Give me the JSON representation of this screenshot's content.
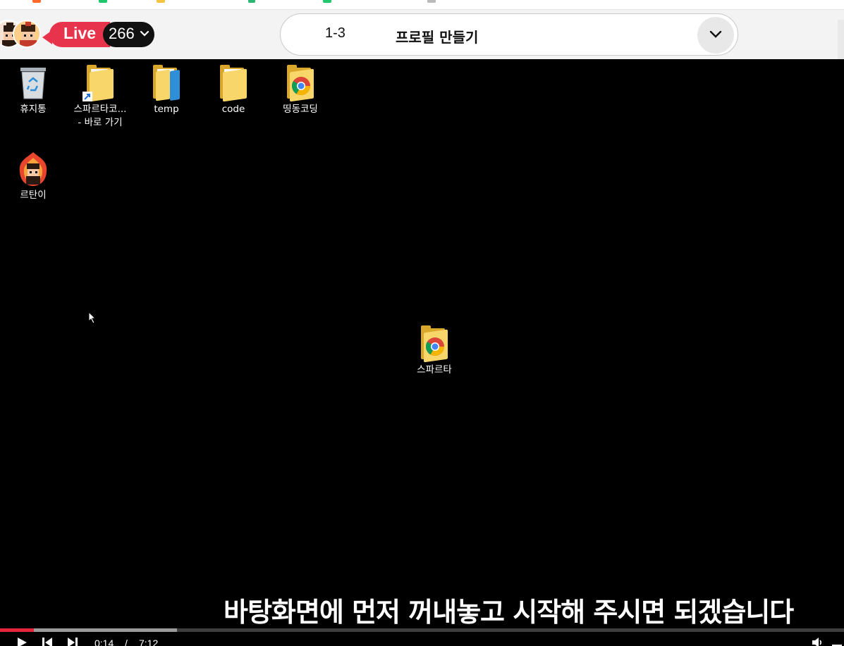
{
  "header": {
    "live_label": "Live",
    "viewer_count": "266",
    "lesson_number": "1-3",
    "lesson_title": "프로필 만들기"
  },
  "desktop": {
    "icons": [
      {
        "label": "휴지통",
        "icon": "recycle-bin-icon"
      },
      {
        "label": "스파르타코...",
        "label2": "- 바로 가기",
        "icon": "folder-shortcut-icon"
      },
      {
        "label": "temp",
        "icon": "folder-icon"
      },
      {
        "label": "code",
        "icon": "folder-icon"
      },
      {
        "label": "띵동코딩",
        "icon": "chrome-folder-icon"
      },
      {
        "label": "르탄이",
        "icon": "rtan-mascot-icon"
      },
      {
        "label": "스파르타",
        "icon": "chrome-folder-icon"
      }
    ]
  },
  "subtitle": "바탕화면에 먼저 꺼내놓고 시작해 주시면 되겠습니다",
  "player": {
    "current_time": "0:14",
    "separator": "/",
    "duration": "7:12",
    "progress_fraction": 0.04,
    "buffered_fraction": 0.21
  },
  "colors": {
    "live_red": "#e7334b",
    "progress_red": "#e5263a",
    "folder_yellow": "#f8d66a"
  }
}
